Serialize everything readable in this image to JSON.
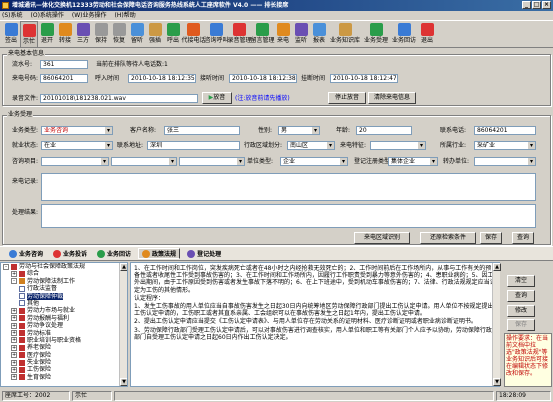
{
  "window": {
    "title": "增城通讯—体化交换机12333劳动和社会保障电话咨询服务热线系统人工座席软件 V4.0 —— 排长接席",
    "controls": [
      "_",
      "□",
      "×"
    ]
  },
  "menu": [
    "(S)系统",
    "(O)系统操作",
    "(W)业务操作",
    "(H)帮助"
  ],
  "toolbar": [
    "签出",
    "示忙",
    "退开",
    "转接",
    "三方",
    "保持",
    "恢复",
    "留听",
    "强插",
    "呼出",
    "代接电话",
    "咨询呼叫",
    "录音管理",
    "留言管理",
    "来电",
    "监听",
    "报表",
    "业务知识库",
    "业务受理",
    "业务回访",
    "退出"
  ],
  "incoming": {
    "title": "来电基本信息",
    "serial_label": "流水号:",
    "serial_value": "361",
    "queue_label": "当前在排队等待人电话数:1",
    "caller_label": "来电号码:",
    "caller_value": "86064201",
    "queue_time_label": "呼入时间",
    "queue_time_value": "2010-10-18 18:12:35",
    "answer_time_label": "接听时间",
    "answer_time_value": "2010-10-18 18:12:38",
    "hangup_time_label": "挂断时间",
    "hangup_time_value": "2010-10-18 18:12:47",
    "rec_label": "录音文件:",
    "rec_value": "20101018\\181238.021.wav",
    "play_label": "放音",
    "hint": "(注:放音前请先播放)",
    "stop_label": "停止放音",
    "clear_label": "清除来电信息"
  },
  "business": {
    "title": "业务受理",
    "type_label": "业务类型:",
    "type_value": "业务咨询",
    "customer_label": "客户名称:",
    "customer_value": "张三",
    "gender_label": "性别:",
    "gender_value": "男",
    "age_label": "年龄:",
    "age_value": "20",
    "phone_label": "联系电话:",
    "phone_value": "86064201",
    "employment_label": "就业状态:",
    "employment_value": "在业",
    "address_label": "联系地址:",
    "address_value": "深圳",
    "district_label": "行政区域划分:",
    "district_value": "南山区",
    "feature_label": "来电特征:",
    "industry_label": "所属行业:",
    "industry_value": "采矿业",
    "consult_label": "咨询项目:",
    "unit_type_label": "单位类型:",
    "unit_type_value": "企业",
    "reg_type_label": "登记注册类型:",
    "reg_type_value": "集体企业",
    "transfer_label": "转办单位:",
    "record_label": "来电记录:",
    "result_label": "处理结果:",
    "area_btn": "来电区域识别",
    "restore_btn": "还原检索条件",
    "save_btn": "保存",
    "query_btn": "查询"
  },
  "tabs": [
    "业务咨询",
    "业务投诉",
    "业务回访",
    "政策法规",
    "登记处理"
  ],
  "tree": [
    {
      "label": "劳动与社会保障政策法规",
      "level": 0,
      "exp": "-",
      "kind": "closed"
    },
    {
      "label": "综合",
      "level": 1,
      "exp": "+",
      "kind": "closed"
    },
    {
      "label": "劳动保障法制工作",
      "level": 1,
      "exp": "-",
      "kind": "open"
    },
    {
      "label": "行政法监督",
      "level": 2,
      "exp": "",
      "kind": "page"
    },
    {
      "label": "劳动保障仲裁",
      "level": 2,
      "exp": "",
      "kind": "page",
      "selected": true
    },
    {
      "label": "其他",
      "level": 2,
      "exp": "",
      "kind": "page"
    },
    {
      "label": "劳动力市场与就业",
      "level": 1,
      "exp": "+",
      "kind": "closed"
    },
    {
      "label": "劳动报酬与福利",
      "level": 1,
      "exp": "+",
      "kind": "closed"
    },
    {
      "label": "劳动争议处理",
      "level": 1,
      "exp": "+",
      "kind": "closed"
    },
    {
      "label": "劳动标准",
      "level": 1,
      "exp": "+",
      "kind": "closed"
    },
    {
      "label": "职业培训与职业资格",
      "level": 1,
      "exp": "+",
      "kind": "closed"
    },
    {
      "label": "养老保险",
      "level": 1,
      "exp": "+",
      "kind": "closed"
    },
    {
      "label": "医疗保险",
      "level": 1,
      "exp": "+",
      "kind": "closed"
    },
    {
      "label": "失业保险",
      "level": 1,
      "exp": "+",
      "kind": "closed"
    },
    {
      "label": "工伤保险",
      "level": 1,
      "exp": "+",
      "kind": "closed"
    },
    {
      "label": "生育保险",
      "level": 1,
      "exp": "+",
      "kind": "closed"
    }
  ],
  "article": [
    "1、在工作时间和工作岗位，突发疾病死亡或者在48小时之内经抢救无效死亡的；2、工作时间前后在工作场所内，从事与工作有关的预备性或者收尾性工作受到事故伤害的；3、在工作时间和工作场所内，因履行工作职责受到暴力等意外伤害的；4、患职业病的；5、因工外出期间，由于工作原因受到伤害或者发生事故下落不明的；6、在上下班途中，受到机动车事故伤害的；7、法律、行政法规规定应当认定为工伤的其他情形。",
    "认定程序：",
    "1、发生工伤事故的用人单位应当自事故伤害发生之日起30日内向统筹地区劳动保障行政部门提出工伤认定申请。用人单位不按规定提出工伤认定申请的，工伤职工或者其直系亲属、工会组织可以在事故伤害发生之日起1年内，提出工伤认定申请。",
    "2、提出工伤认定申请应当提交《工伤认定申请表》、与用人单位存在劳动关系的证明材料、医疗诊断证明或者职业病诊断证明书。",
    "3、劳动保障行政部门受理工伤认定申请后，可以对事故伤害进行调查核实，用人单位和职工等有关部门个人应予以协助，劳动保障行政部门自受理工伤认定申请之日起60日内作出工伤认定决定。"
  ],
  "side_buttons": [
    "清空",
    "查询",
    "修改",
    "保存"
  ],
  "note": "操作要求：在当前文档中拉选\"政策法规\"等业务知识后可接在编辑状态下修改和保存。",
  "status": [
    "座席工号：2002",
    "示忙",
    "",
    "18:28:09"
  ]
}
